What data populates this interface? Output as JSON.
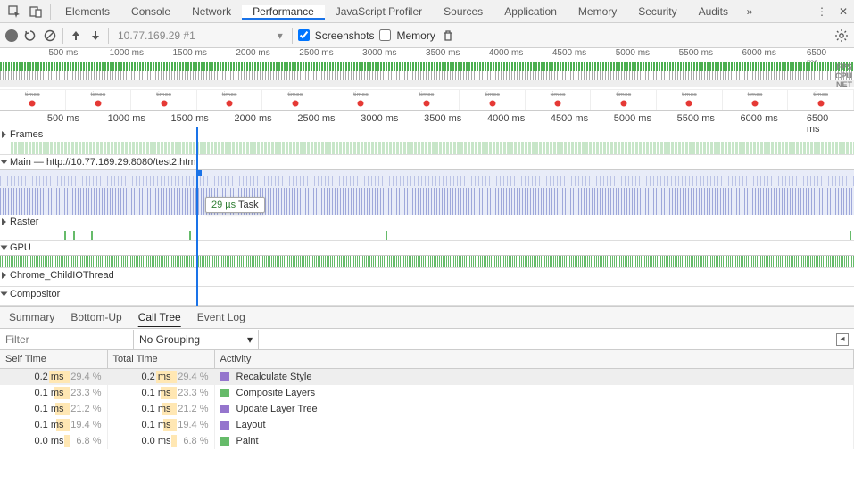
{
  "tabs": [
    "Elements",
    "Console",
    "Network",
    "Performance",
    "JavaScript Profiler",
    "Sources",
    "Application",
    "Memory",
    "Security",
    "Audits"
  ],
  "active_tab": "Performance",
  "toolbar": {
    "profile_label": "10.77.169.29 #1",
    "screenshots_label": "Screenshots",
    "screenshots_checked": true,
    "memory_label": "Memory",
    "memory_checked": false
  },
  "overview": {
    "ticks": [
      "500 ms",
      "1000 ms",
      "1500 ms",
      "2000 ms",
      "2500 ms",
      "3000 ms",
      "3500 ms",
      "4000 ms",
      "4500 ms",
      "5000 ms",
      "5500 ms",
      "6000 ms",
      "6500 ms"
    ],
    "labels": {
      "fps": "FPS",
      "cpu": "CPU",
      "net": "NET"
    },
    "shot_label": "times"
  },
  "main_ruler": [
    "500 ms",
    "1000 ms",
    "1500 ms",
    "2000 ms",
    "2500 ms",
    "3000 ms",
    "3500 ms",
    "4000 ms",
    "4500 ms",
    "5000 ms",
    "5500 ms",
    "6000 ms",
    "6500 ms"
  ],
  "tracks": {
    "frames": "Frames",
    "main": "Main — http://10.77.169.29:8080/test2.html",
    "raster": "Raster",
    "gpu": "GPU",
    "chio": "Chrome_ChildIOThread",
    "compositor": "Compositor"
  },
  "tooltip": {
    "duration": "29 µs",
    "label": "Task"
  },
  "bottom_tabs": [
    "Summary",
    "Bottom-Up",
    "Call Tree",
    "Event Log"
  ],
  "active_bottom_tab": "Call Tree",
  "filter": {
    "placeholder": "Filter",
    "grouping": "No Grouping"
  },
  "columns": [
    "Self Time",
    "Total Time",
    "Activity"
  ],
  "rows": [
    {
      "self_ms": "0.2 ms",
      "self_pct": "29.4 %",
      "self_bar": 29.4,
      "total_ms": "0.2 ms",
      "total_pct": "29.4 %",
      "total_bar": 29.4,
      "color": "purple",
      "activity": "Recalculate Style"
    },
    {
      "self_ms": "0.1 ms",
      "self_pct": "23.3 %",
      "self_bar": 23.3,
      "total_ms": "0.1 ms",
      "total_pct": "23.3 %",
      "total_bar": 23.3,
      "color": "green",
      "activity": "Composite Layers"
    },
    {
      "self_ms": "0.1 ms",
      "self_pct": "21.2 %",
      "self_bar": 21.2,
      "total_ms": "0.1 ms",
      "total_pct": "21.2 %",
      "total_bar": 21.2,
      "color": "purple",
      "activity": "Update Layer Tree"
    },
    {
      "self_ms": "0.1 ms",
      "self_pct": "19.4 %",
      "self_bar": 19.4,
      "total_ms": "0.1 ms",
      "total_pct": "19.4 %",
      "total_bar": 19.4,
      "color": "purple",
      "activity": "Layout"
    },
    {
      "self_ms": "0.0 ms",
      "self_pct": "6.8 %",
      "self_bar": 6.8,
      "total_ms": "0.0 ms",
      "total_pct": "6.8 %",
      "total_bar": 6.8,
      "color": "green",
      "activity": "Paint"
    }
  ]
}
